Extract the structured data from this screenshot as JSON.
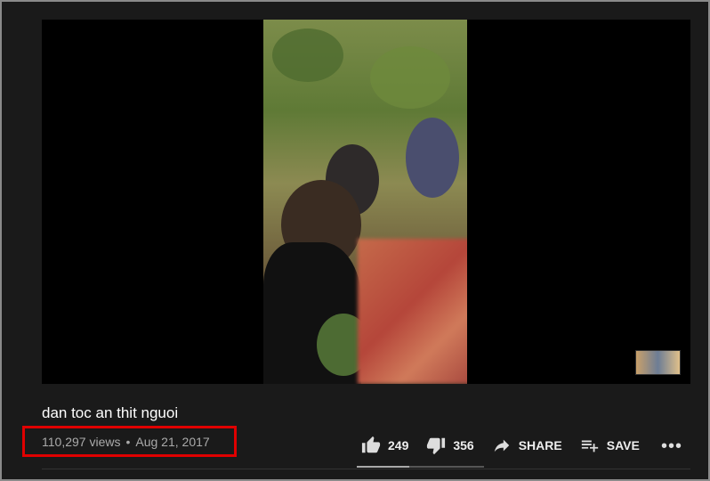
{
  "video": {
    "title": "dan toc an thit nguoi",
    "views": "110,297 views",
    "separator": "•",
    "date": "Aug 21, 2017"
  },
  "actions": {
    "likes": "249",
    "dislikes": "356",
    "share_label": "SHARE",
    "save_label": "SAVE",
    "more": "•••"
  },
  "likes_ratio": 0.41,
  "colors": {
    "highlight": "#e00000",
    "background": "#181818"
  }
}
